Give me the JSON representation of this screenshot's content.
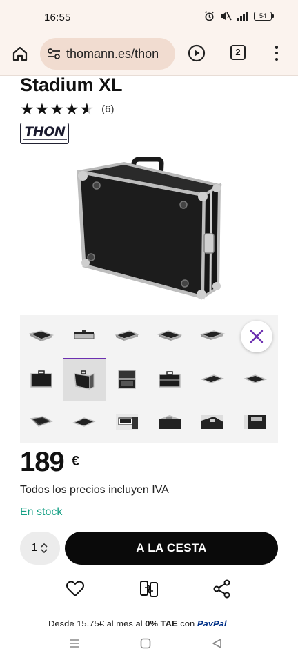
{
  "status_bar": {
    "time": "16:55",
    "battery": "54"
  },
  "browser": {
    "url": "thomann.es/thon",
    "tab_count": "2"
  },
  "product": {
    "title": "Stadium XL",
    "rating": 4.5,
    "review_count": "(6)",
    "brand_logo_text": "THON"
  },
  "price": {
    "amount": "189",
    "currency": "€"
  },
  "tax_note": "Todos los precios incluyen IVA",
  "stock_status": "En stock",
  "quantity": "1",
  "cart_label": "A LA CESTA",
  "financing": {
    "text": "Desde 15,75€ al mes al",
    "rate": "0% TAE",
    "with": "con",
    "provider": "PayPal"
  },
  "icons": {
    "home": "home-icon",
    "site_settings": "tune-icon",
    "play": "play-icon",
    "menu": "more-vert-icon",
    "close": "close-icon",
    "wishlist": "heart-icon",
    "compare": "compare-icon",
    "share": "share-icon"
  },
  "colors": {
    "accent": "#6c2fb0",
    "stock": "#16a085",
    "cart_bg": "#0a0a0a",
    "browser_bar": "#fbf3ee"
  }
}
